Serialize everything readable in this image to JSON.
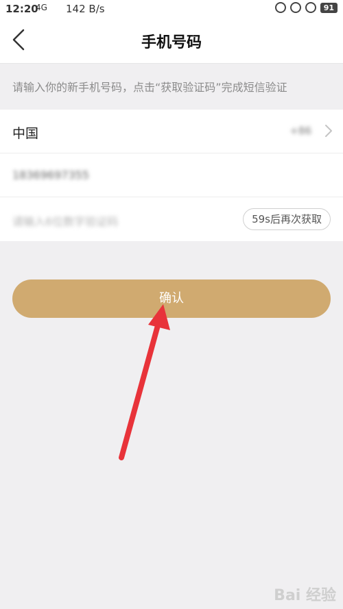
{
  "status_bar": {
    "time": "12:20",
    "signal": "4G",
    "net_speed": "142 B/s",
    "battery": "91"
  },
  "header": {
    "title": "手机号码"
  },
  "hint": "请输入你的新手机号码，点击“获取验证码”完成短信验证",
  "form": {
    "country_label": "中国",
    "country_code": "+86",
    "phone_value": "18369697355",
    "code_placeholder": "请输入6位数字验证码",
    "sms_button_label": "59s后再次获取"
  },
  "confirm_label": "确认",
  "watermark": "Bai 经验",
  "colors": {
    "accent": "#d0aa70",
    "arrow": "#e8333a",
    "background": "#f0eff1"
  }
}
